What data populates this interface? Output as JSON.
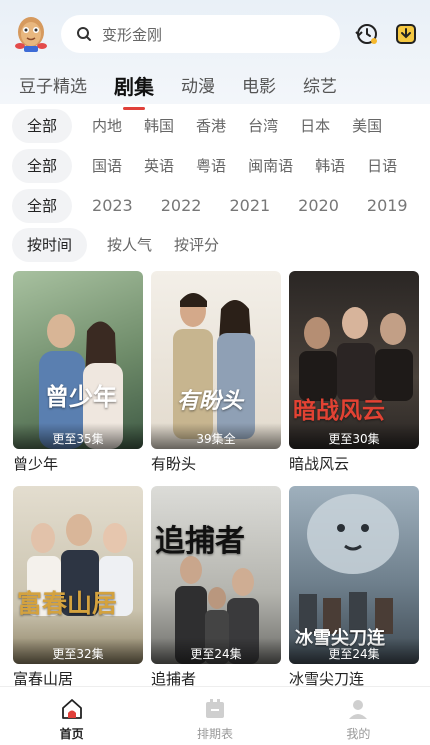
{
  "header": {
    "search_placeholder": "变形金刚"
  },
  "tabs": [
    {
      "label": "豆子精选"
    },
    {
      "label": "剧集"
    },
    {
      "label": "动漫"
    },
    {
      "label": "电影"
    },
    {
      "label": "综艺"
    }
  ],
  "active_tab": "剧集",
  "filters": {
    "region": [
      "全部",
      "内地",
      "韩国",
      "香港",
      "台湾",
      "日本",
      "美国"
    ],
    "language": [
      "全部",
      "国语",
      "英语",
      "粤语",
      "闽南语",
      "韩语",
      "日语"
    ],
    "year": [
      "全部",
      "2023",
      "2022",
      "2021",
      "2020",
      "2019"
    ],
    "sort": [
      "按时间",
      "按人气",
      "按评分"
    ]
  },
  "cards": [
    {
      "title": "曾少年",
      "poster_text": "曾少年",
      "episodes": "更至35集",
      "colors": [
        "#6f8c6a",
        "#c9d8c0"
      ]
    },
    {
      "title": "有盼头",
      "poster_text": "有盼头",
      "episodes": "39集全",
      "colors": [
        "#c8c2b4",
        "#ede8df"
      ]
    },
    {
      "title": "暗战风云",
      "poster_text": "暗战风云",
      "episodes": "更至30集",
      "colors": [
        "#3a3532",
        "#7a6f62"
      ]
    },
    {
      "title": "富春山居",
      "poster_text": "富春山居",
      "episodes": "更至32集",
      "colors": [
        "#b9b6a5",
        "#e7e2d2"
      ]
    },
    {
      "title": "追捕者",
      "poster_text": "追捕者",
      "episodes": "更至24集",
      "colors": [
        "#8c8c8a",
        "#d6d6d2"
      ]
    },
    {
      "title": "冰雪尖刀连",
      "poster_text": "冰雪尖刀连",
      "episodes": "更至24集",
      "colors": [
        "#6c7c88",
        "#c9d2d8"
      ]
    }
  ],
  "bottom_nav": [
    {
      "label": "首页"
    },
    {
      "label": "排期表"
    },
    {
      "label": "我的"
    }
  ],
  "accent_color": "#e0403a"
}
